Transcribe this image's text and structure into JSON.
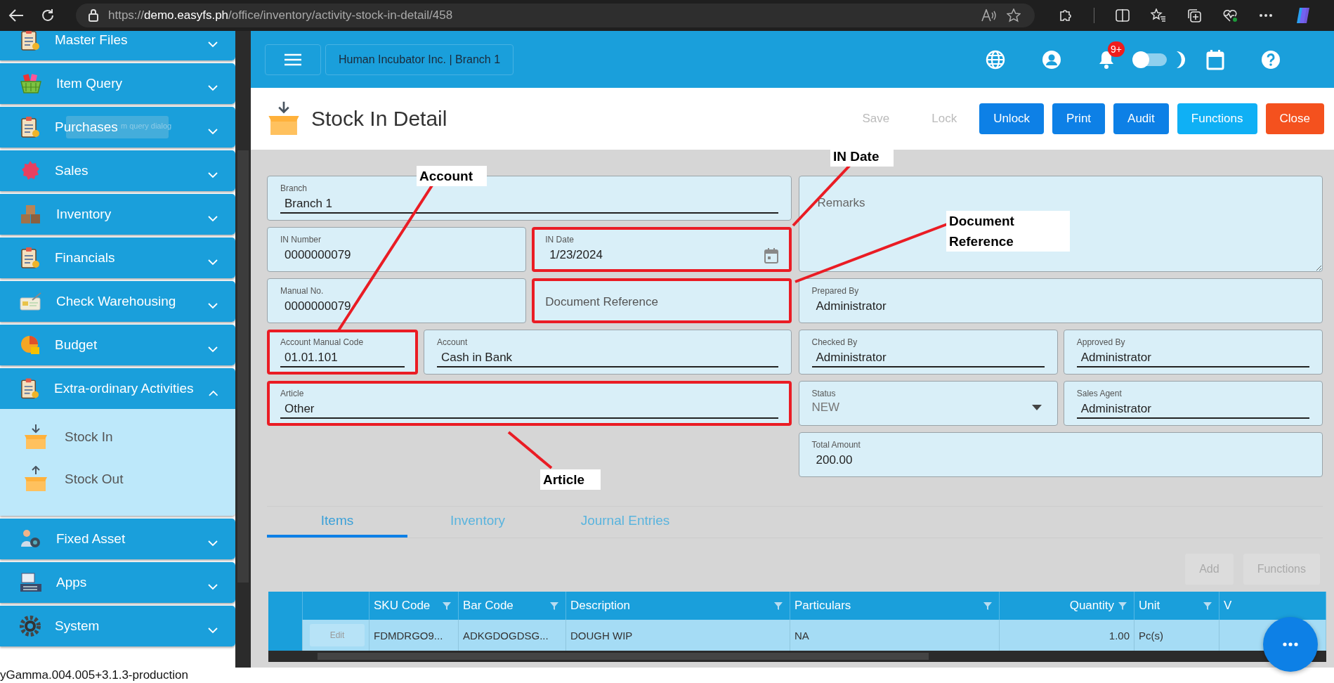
{
  "browser": {
    "url": {
      "scheme": "https://",
      "host": "demo.easyfs.ph",
      "path": "/office/inventory/activity-stock-in-detail/458"
    }
  },
  "sidebar": {
    "tooltip": "m query dialog",
    "items": [
      {
        "label": "Master Files",
        "expanded": false
      },
      {
        "label": "Item Query",
        "expanded": false
      },
      {
        "label": "Purchases",
        "expanded": false
      },
      {
        "label": "Sales",
        "expanded": false
      },
      {
        "label": "Inventory",
        "expanded": false
      },
      {
        "label": "Financials",
        "expanded": false
      },
      {
        "label": "Check Warehousing",
        "expanded": false
      },
      {
        "label": "Budget",
        "expanded": false
      },
      {
        "label": "Extra-ordinary Activities",
        "expanded": true,
        "children": [
          {
            "label": "Stock In"
          },
          {
            "label": "Stock Out"
          }
        ]
      },
      {
        "label": "Fixed Asset",
        "expanded": false
      },
      {
        "label": "Apps",
        "expanded": false
      },
      {
        "label": "System",
        "expanded": false
      }
    ]
  },
  "header": {
    "company": "Human Incubator Inc. | Branch 1",
    "notifications": "9+",
    "dark_mode": false
  },
  "page": {
    "title": "Stock In Detail",
    "actions": [
      {
        "label": "Save",
        "kind": "plain",
        "disabled": true
      },
      {
        "label": "Lock",
        "kind": "plain",
        "disabled": true
      },
      {
        "label": "Unlock",
        "kind": "primary",
        "disabled": false
      },
      {
        "label": "Print",
        "kind": "primary",
        "disabled": false
      },
      {
        "label": "Audit",
        "kind": "primary",
        "disabled": false
      },
      {
        "label": "Functions",
        "kind": "info",
        "disabled": false
      },
      {
        "label": "Close",
        "kind": "danger",
        "disabled": false
      }
    ]
  },
  "form": {
    "left_rows": [
      [
        {
          "kind": "text",
          "label": "Branch",
          "value": "Branch 1",
          "editable": true,
          "highlighted": false
        }
      ],
      [
        {
          "kind": "text",
          "label": "IN Number",
          "value": "0000000079",
          "editable": false,
          "highlighted": false
        },
        {
          "kind": "date",
          "label": "IN Date",
          "value": "1/23/2024",
          "editable": false,
          "highlighted": true
        }
      ],
      [
        {
          "kind": "text",
          "label": "Manual No.",
          "value": "0000000079",
          "editable": false,
          "highlighted": false
        },
        {
          "kind": "empty",
          "placeholder": "Document Reference",
          "highlighted": true
        }
      ],
      [
        {
          "kind": "text",
          "label": "Account Manual Code",
          "value": "01.01.101",
          "editable": true,
          "highlighted": true
        },
        {
          "kind": "text",
          "label": "Account",
          "value": "Cash in Bank",
          "editable": true,
          "highlighted": false
        }
      ],
      [
        {
          "kind": "text",
          "label": "Article",
          "value": "Other",
          "editable": true,
          "highlighted": true
        }
      ]
    ],
    "remarks": {
      "placeholder": "Remarks"
    },
    "right_rows": [
      [
        {
          "kind": "text",
          "label": "Prepared By",
          "value": "Administrator",
          "editable": false,
          "highlighted": false
        }
      ],
      [
        {
          "kind": "text",
          "label": "Checked By",
          "value": "Administrator",
          "editable": true,
          "highlighted": false
        },
        {
          "kind": "text",
          "label": "Approved By",
          "value": "Administrator",
          "editable": true,
          "highlighted": false
        }
      ],
      [
        {
          "kind": "select",
          "label": "Status",
          "value": "NEW",
          "highlighted": false
        },
        {
          "kind": "text",
          "label": "Sales Agent",
          "value": "Administrator",
          "editable": true,
          "highlighted": false
        }
      ],
      [
        {
          "kind": "text",
          "label": "Total Amount",
          "value": "200.00",
          "editable": false,
          "highlighted": false
        }
      ]
    ]
  },
  "annotations": [
    {
      "label": "Account"
    },
    {
      "label": "IN Date"
    },
    {
      "label": "Document Reference"
    },
    {
      "label": "Article"
    }
  ],
  "detail_tabs": [
    {
      "label": "Items",
      "selected": true
    },
    {
      "label": "Inventory",
      "selected": false
    },
    {
      "label": "Journal Entries",
      "selected": false
    }
  ],
  "grid_actions": [
    {
      "label": "Add",
      "disabled": true
    },
    {
      "label": "Functions",
      "disabled": true
    }
  ],
  "table": {
    "columns": [
      {
        "label": "SKU Code",
        "filter": true,
        "kind": "text"
      },
      {
        "label": "Bar Code",
        "filter": true,
        "kind": "text"
      },
      {
        "label": "Description",
        "filter": true,
        "kind": "text"
      },
      {
        "label": "Particulars",
        "filter": true,
        "kind": "text"
      },
      {
        "label": "Quantity",
        "filter": true,
        "kind": "number"
      },
      {
        "label": "Unit",
        "filter": true,
        "kind": "text"
      },
      {
        "label": "V",
        "filter": false,
        "kind": "text"
      }
    ],
    "rows": [
      {
        "selected": true,
        "edit": {
          "label": "Edit",
          "disabled": true
        },
        "cells": [
          "FDMDRGO9...",
          "ADKGDOGDSG...",
          "DOUGH WIP",
          "NA",
          "1.00",
          "Pc(s)"
        ]
      }
    ]
  },
  "status_bar": "yGamma.004.005+3.1.3-production"
}
